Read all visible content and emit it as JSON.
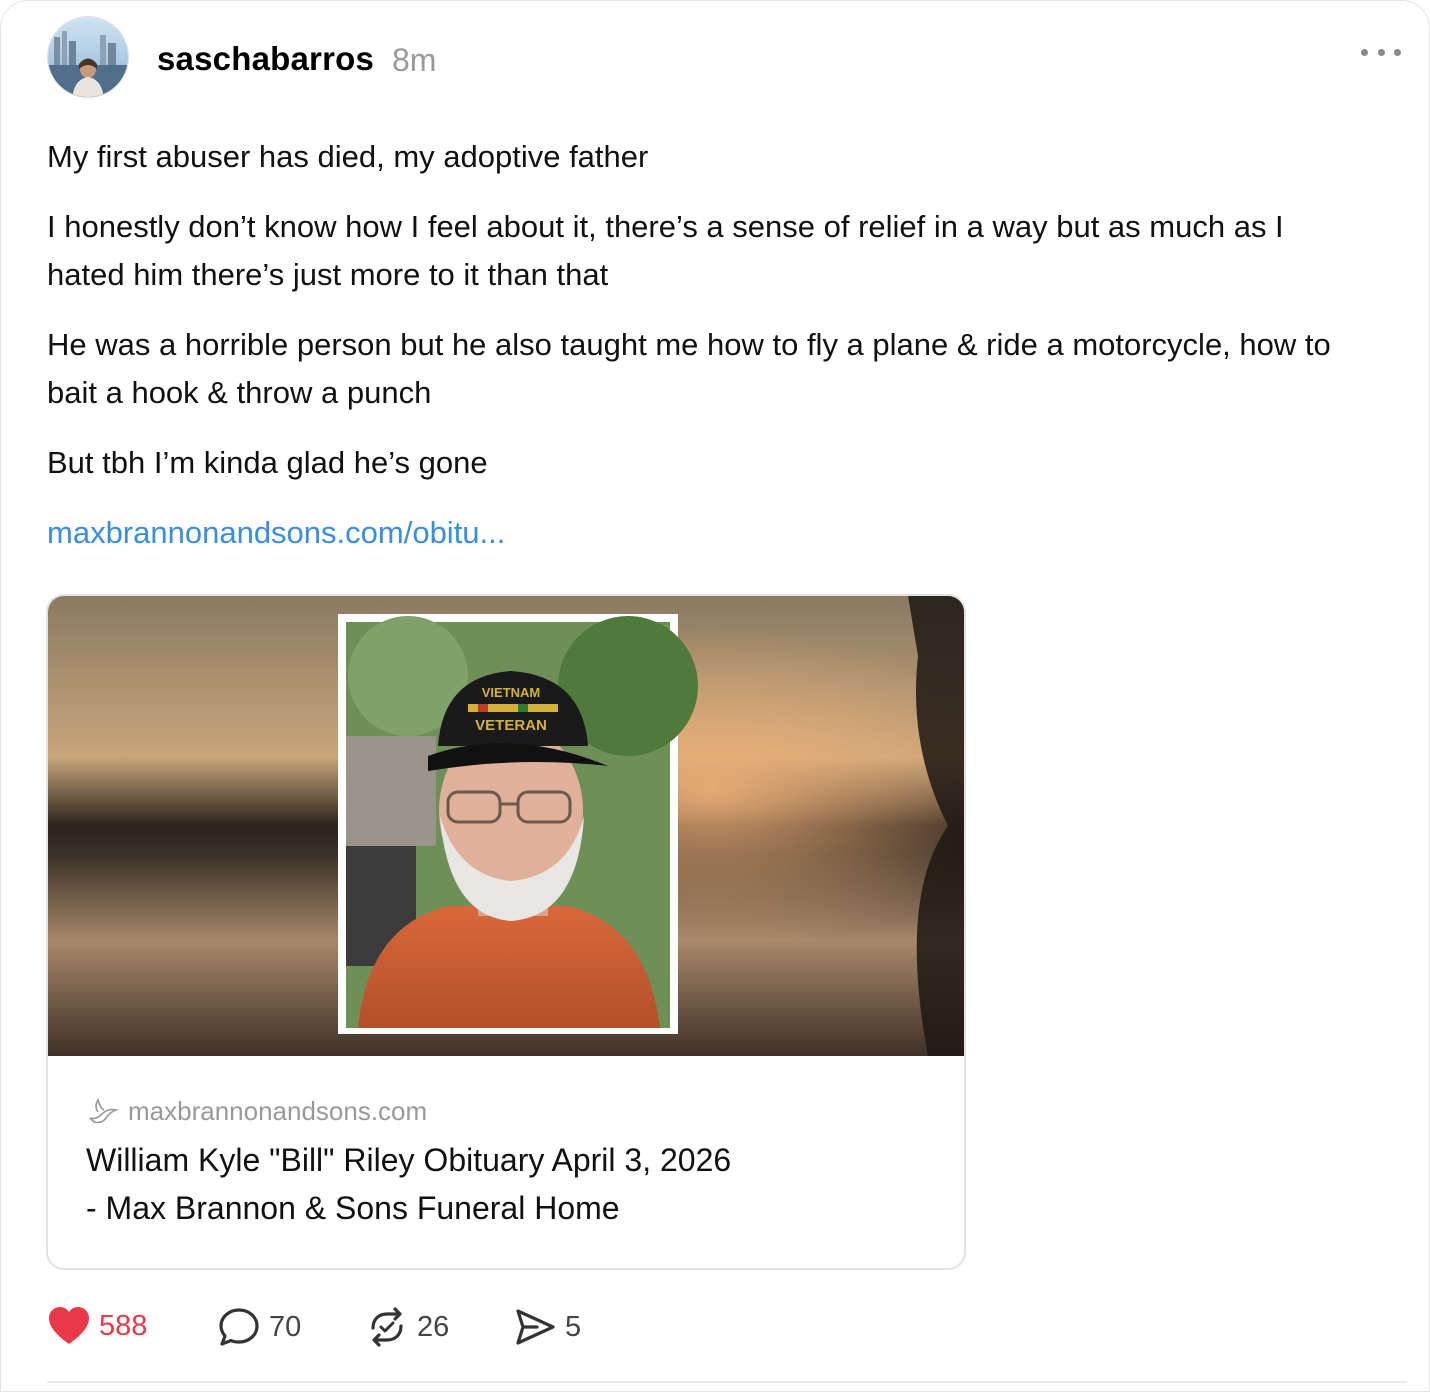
{
  "post": {
    "username": "saschabarros",
    "time": "8m",
    "paragraphs": [
      "My first abuser has died, my adoptive father",
      "I honestly don’t know how I feel about it, there’s a sense of relief in a way but as much as I hated him there’s just more to it than that",
      "He was a horrible person but he also taught me how to fly a plane & ride a motorcycle, how to bait a hook & throw a punch",
      "But tbh I’m kinda glad he’s gone"
    ],
    "link_text": "maxbrannonandsons.com/obitu..."
  },
  "preview": {
    "hat_text_top": "VIETNAM",
    "hat_text_bottom": "VETERAN",
    "site": "maxbrannonandsons.com",
    "title_line1": "William Kyle \"Bill\" Riley Obituary April 3, 2026",
    "title_line2": "- Max Brannon & Sons Funeral Home"
  },
  "actions": {
    "likes": "588",
    "comments": "70",
    "reposts": "26",
    "shares": "5"
  },
  "colors": {
    "link": "#3b8de0",
    "like": "#e8394a",
    "muted": "#999999"
  },
  "icons": [
    "more-icon",
    "heart-icon",
    "comment-icon",
    "repost-icon",
    "share-icon",
    "dove-icon"
  ]
}
